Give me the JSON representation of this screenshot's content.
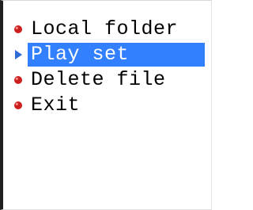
{
  "menu": {
    "items": [
      {
        "label": "Local folder",
        "icon": "red-dot-icon",
        "selected": false
      },
      {
        "label": "Play set",
        "icon": "blue-arrow-icon",
        "selected": true
      },
      {
        "label": "Delete file",
        "icon": "red-dot-icon",
        "selected": false
      },
      {
        "label": "Exit",
        "icon": "red-dot-icon",
        "selected": false
      }
    ]
  },
  "colors": {
    "selection": "#3380ff",
    "dot": "#cc1f1f",
    "arrow": "#2e6bd6"
  }
}
